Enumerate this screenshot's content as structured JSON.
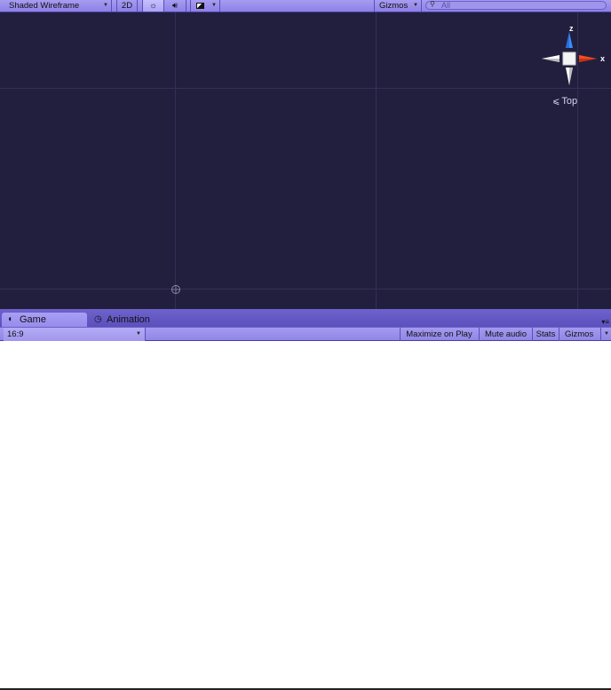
{
  "scene_toolbar": {
    "draw_mode": "Shaded Wireframe",
    "mode_2d": "2D",
    "lighting_icon": "sun-icon",
    "audio_icon": "speaker-icon",
    "effects_icon": "image-icon",
    "gizmos": "Gizmos",
    "search_placeholder": "All"
  },
  "scene_view": {
    "background": "#221f3e",
    "gizmo": {
      "z_label": "z",
      "x_label": "x"
    },
    "view_label": "Top"
  },
  "tabs": [
    {
      "label": "Game",
      "icon": "pacman-icon"
    },
    {
      "label": "Animation",
      "icon": "clock-icon"
    }
  ],
  "game_toolbar": {
    "aspect": "16:9",
    "maximize": "Maximize on Play",
    "mute": "Mute audio",
    "stats": "Stats",
    "gizmos": "Gizmos"
  }
}
